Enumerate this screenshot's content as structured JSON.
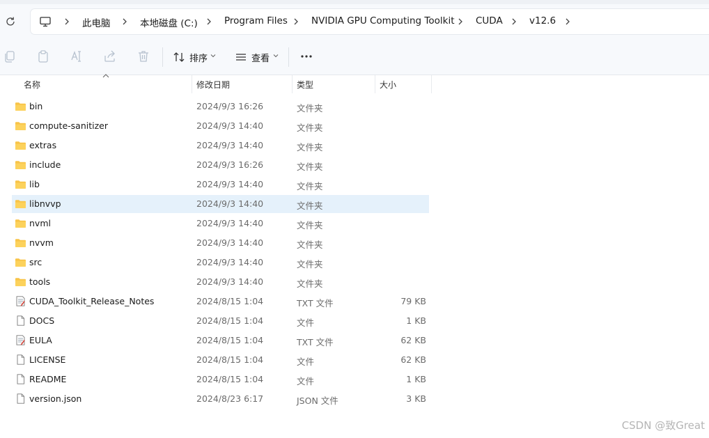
{
  "address_bar": {
    "crumbs": [
      "此电脑",
      "本地磁盘 (C:)",
      "Program Files",
      "NVIDIA GPU Computing Toolkit",
      "CUDA",
      "v12.6"
    ],
    "icons": [
      "refresh-icon",
      "computer-icon",
      "chevron-right-icon"
    ]
  },
  "toolbar": {
    "sort_label": "排序",
    "view_label": "查看",
    "icons": [
      "copy-icon",
      "paste-icon",
      "rename-icon",
      "share-icon",
      "delete-icon",
      "sort-icon",
      "view-icon",
      "more-icon"
    ]
  },
  "columns": {
    "name": "名称",
    "modified": "修改日期",
    "type": "类型",
    "size": "大小"
  },
  "files": [
    {
      "name": "bin",
      "modified": "2024/9/3 16:26",
      "type": "文件夹",
      "size": "",
      "icon": "folder"
    },
    {
      "name": "compute-sanitizer",
      "modified": "2024/9/3 14:40",
      "type": "文件夹",
      "size": "",
      "icon": "folder"
    },
    {
      "name": "extras",
      "modified": "2024/9/3 14:40",
      "type": "文件夹",
      "size": "",
      "icon": "folder"
    },
    {
      "name": "include",
      "modified": "2024/9/3 16:26",
      "type": "文件夹",
      "size": "",
      "icon": "folder"
    },
    {
      "name": "lib",
      "modified": "2024/9/3 14:40",
      "type": "文件夹",
      "size": "",
      "icon": "folder"
    },
    {
      "name": "libnvvp",
      "modified": "2024/9/3 14:40",
      "type": "文件夹",
      "size": "",
      "icon": "folder",
      "selected": true
    },
    {
      "name": "nvml",
      "modified": "2024/9/3 14:40",
      "type": "文件夹",
      "size": "",
      "icon": "folder"
    },
    {
      "name": "nvvm",
      "modified": "2024/9/3 14:40",
      "type": "文件夹",
      "size": "",
      "icon": "folder"
    },
    {
      "name": "src",
      "modified": "2024/9/3 14:40",
      "type": "文件夹",
      "size": "",
      "icon": "folder"
    },
    {
      "name": "tools",
      "modified": "2024/9/3 14:40",
      "type": "文件夹",
      "size": "",
      "icon": "folder"
    },
    {
      "name": "CUDA_Toolkit_Release_Notes",
      "modified": "2024/8/15 1:04",
      "type": "TXT 文件",
      "size": "79 KB",
      "icon": "txt"
    },
    {
      "name": "DOCS",
      "modified": "2024/8/15 1:04",
      "type": "文件",
      "size": "1 KB",
      "icon": "file"
    },
    {
      "name": "EULA",
      "modified": "2024/8/15 1:04",
      "type": "TXT 文件",
      "size": "62 KB",
      "icon": "txt"
    },
    {
      "name": "LICENSE",
      "modified": "2024/8/15 1:04",
      "type": "文件",
      "size": "62 KB",
      "icon": "file"
    },
    {
      "name": "README",
      "modified": "2024/8/15 1:04",
      "type": "文件",
      "size": "1 KB",
      "icon": "file"
    },
    {
      "name": "version.json",
      "modified": "2024/8/23 6:17",
      "type": "JSON 文件",
      "size": "3 KB",
      "icon": "file"
    }
  ],
  "watermark": "CSDN @致Great",
  "colors": {
    "folder": "#f8c448",
    "selection": "#e5f1fb",
    "secondary_text": "#6b6b6b"
  }
}
